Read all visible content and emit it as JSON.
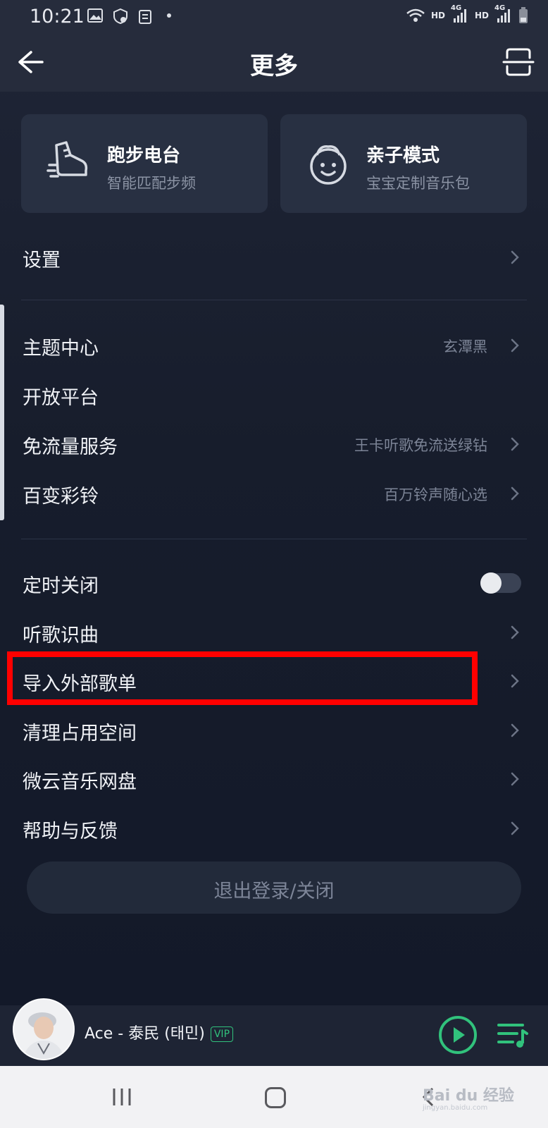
{
  "status_bar": {
    "time": "10:21",
    "network_1": "HD",
    "network_1_type": "4G",
    "network_2": "HD",
    "network_2_type": "4G",
    "icons": [
      "image-icon",
      "vpn-shield-icon",
      "clipboard-icon",
      "dot-icon",
      "wifi-icon",
      "signal-icon",
      "battery-icon"
    ]
  },
  "header": {
    "title": "更多",
    "back_icon": "arrow-left-icon",
    "scan_icon": "scan-icon"
  },
  "cards": [
    {
      "title": "跑步电台",
      "subtitle": "智能匹配步频",
      "icon": "running-shoe-icon"
    },
    {
      "title": "亲子模式",
      "subtitle": "宝宝定制音乐包",
      "icon": "baby-face-icon"
    }
  ],
  "menu": {
    "settings": "设置",
    "theme": {
      "label": "主题中心",
      "value": "玄潭黑"
    },
    "open_platform": "开放平台",
    "free_data": {
      "label": "免流量服务",
      "value": "王卡听歌免流送绿钻"
    },
    "ringtone": {
      "label": "百变彩铃",
      "value": "百万铃声随心选"
    },
    "timer": {
      "label": "定时关闭",
      "enabled": false
    },
    "recognize": "听歌识曲",
    "import_playlist": "导入外部歌单",
    "clean_space": "清理占用空间",
    "weiyun": "微云音乐网盘",
    "help": "帮助与反馈"
  },
  "logout_label": "退出登录/关闭",
  "player": {
    "song": "Ace - 泰民 (태민)",
    "badge": "VIP"
  },
  "colors": {
    "accent_green": "#31c27c",
    "highlight_red": "#ff0000"
  },
  "watermark": {
    "brand": "Bai du 经验",
    "url": "jingyan.baidu.com"
  }
}
